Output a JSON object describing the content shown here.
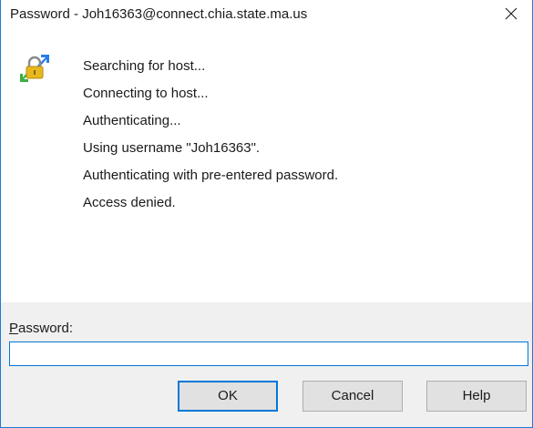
{
  "window": {
    "title": "Password - Joh16363@connect.chia.state.ma.us",
    "close_icon": "close-icon"
  },
  "log": {
    "icon": "key-lock-icon",
    "lines": [
      "Searching for host...",
      "Connecting to host...",
      "Authenticating...",
      "Using username \"Joh16363\".",
      "Authenticating with pre-entered password.",
      "Access denied."
    ]
  },
  "password": {
    "label_accel": "P",
    "label_rest": "assword:",
    "value": "",
    "placeholder": ""
  },
  "buttons": {
    "ok": "OK",
    "cancel": "Cancel",
    "help": "Help"
  },
  "colors": {
    "accent": "#0078d7",
    "panel": "#f0f0f0",
    "button_face": "#e1e1e1"
  }
}
